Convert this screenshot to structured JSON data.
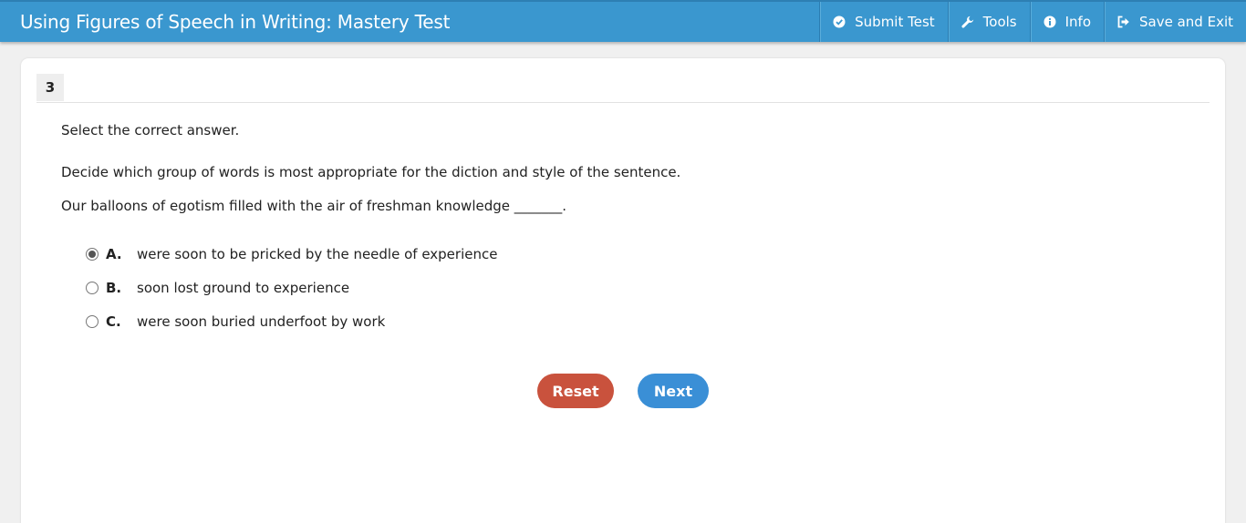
{
  "header": {
    "title": "Using Figures of Speech in Writing: Mastery Test",
    "nav": [
      {
        "label": "Submit Test",
        "icon": "check-circle-icon"
      },
      {
        "label": "Tools",
        "icon": "wrench-icon"
      },
      {
        "label": "Info",
        "icon": "info-icon"
      },
      {
        "label": "Save and Exit",
        "icon": "exit-icon"
      }
    ]
  },
  "question": {
    "number": "3",
    "instruction": "Select the correct answer.",
    "prompt": "Decide which group of words is most appropriate for the diction and style of the sentence.",
    "sentence": "Our balloons of egotism filled with the air of freshman knowledge _______.",
    "options": [
      {
        "letter": "A.",
        "text": "were soon to be pricked by the needle of experience",
        "selected": true
      },
      {
        "letter": "B.",
        "text": "soon lost ground to experience",
        "selected": false
      },
      {
        "letter": "C.",
        "text": "were soon buried underfoot by work",
        "selected": false
      }
    ]
  },
  "buttons": {
    "reset": "Reset",
    "next": "Next"
  },
  "colors": {
    "header_bg": "#3a97cf",
    "reset_bg": "#c9523d",
    "next_bg": "#3a8fd6"
  }
}
